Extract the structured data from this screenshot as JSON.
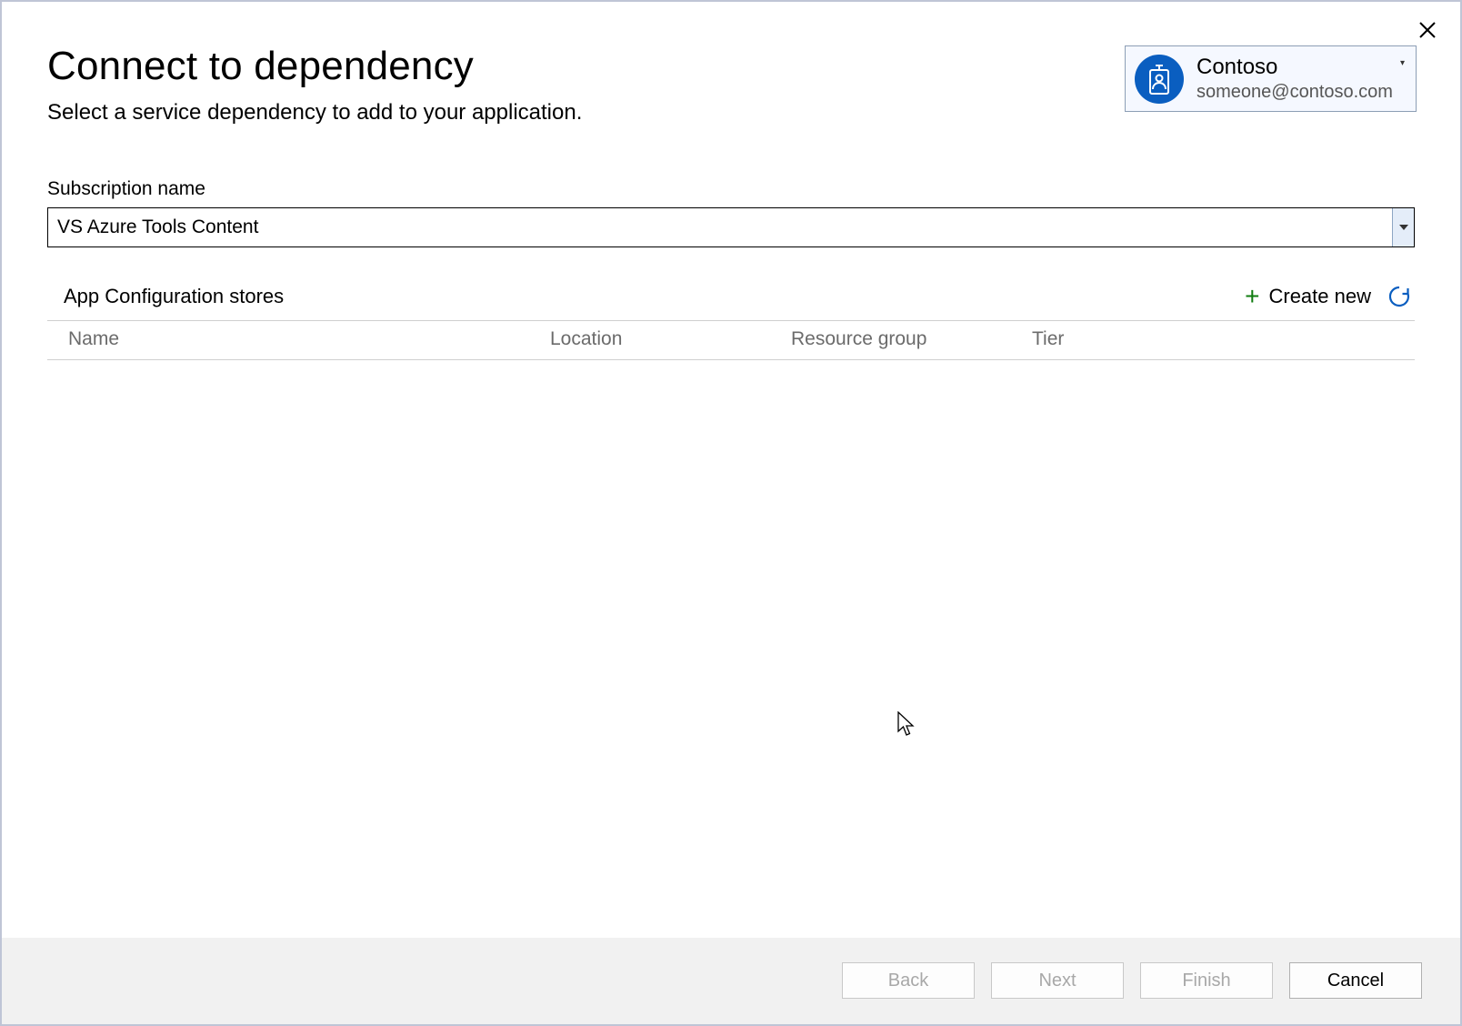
{
  "dialog": {
    "title": "Connect to dependency",
    "subtitle": "Select a service dependency to add to your application."
  },
  "account": {
    "name": "Contoso",
    "email": "someone@contoso.com"
  },
  "subscription": {
    "label": "Subscription name",
    "value": "VS Azure Tools Content"
  },
  "stores": {
    "title": "App Configuration stores",
    "create_new_label": "Create new",
    "columns": {
      "name": "Name",
      "location": "Location",
      "resource_group": "Resource group",
      "tier": "Tier"
    }
  },
  "buttons": {
    "back": "Back",
    "next": "Next",
    "finish": "Finish",
    "cancel": "Cancel"
  }
}
